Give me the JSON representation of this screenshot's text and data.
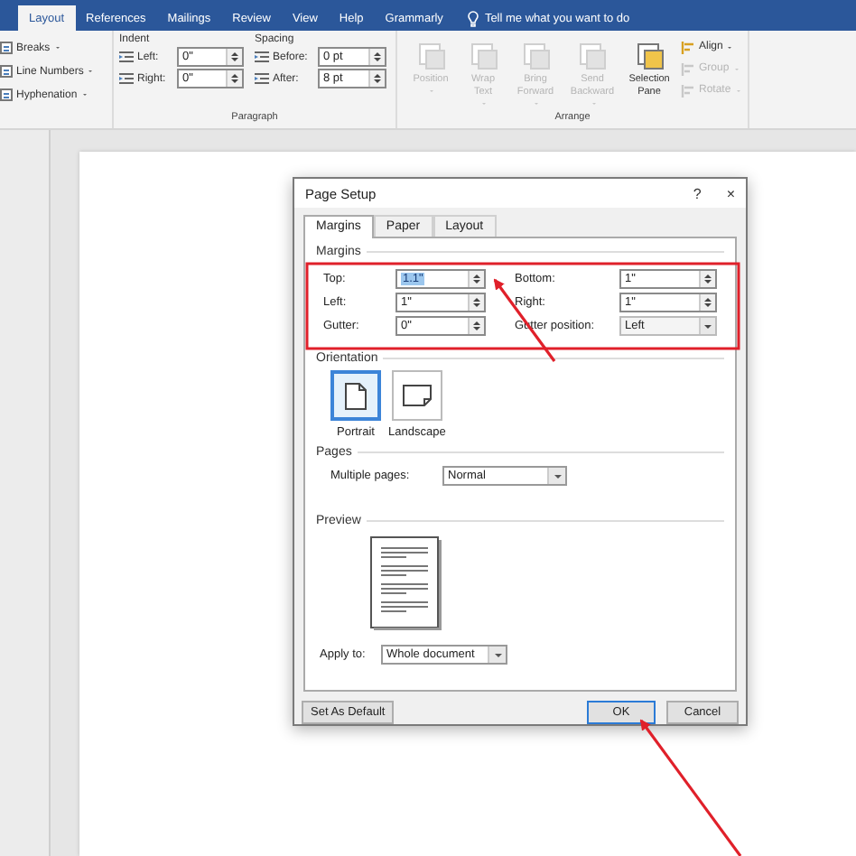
{
  "ribbon": {
    "tabs": [
      {
        "label": "Layout",
        "selected": true
      },
      {
        "label": "References",
        "selected": false
      },
      {
        "label": "Mailings",
        "selected": false
      },
      {
        "label": "Review",
        "selected": false
      },
      {
        "label": "View",
        "selected": false
      },
      {
        "label": "Help",
        "selected": false
      },
      {
        "label": "Grammarly",
        "selected": false
      }
    ],
    "tell_me": "Tell me what you want to do",
    "setup_items": [
      "Breaks",
      "Line Numbers",
      "Hyphenation"
    ],
    "paragraph": {
      "title": "Paragraph",
      "indent_label": "Indent",
      "spacing_label": "Spacing",
      "indent": [
        {
          "label": "Left:",
          "value": "0\""
        },
        {
          "label": "Right:",
          "value": "0\""
        }
      ],
      "spacing": [
        {
          "label": "Before:",
          "value": "0 pt"
        },
        {
          "label": "After:",
          "value": "8 pt"
        }
      ]
    },
    "arrange": {
      "title": "Arrange",
      "large": [
        {
          "label": "Position",
          "disabled": true,
          "dropdown": true
        },
        {
          "label": "Wrap Text",
          "disabled": true,
          "dropdown": true
        },
        {
          "label": "Bring Forward",
          "disabled": true,
          "dropdown": true
        },
        {
          "label": "Send Backward",
          "disabled": true,
          "dropdown": true
        },
        {
          "label": "Selection Pane",
          "disabled": false,
          "dropdown": false
        }
      ],
      "small": [
        {
          "label": "Align",
          "disabled": false
        },
        {
          "label": "Group",
          "disabled": true
        },
        {
          "label": "Rotate",
          "disabled": true
        }
      ]
    }
  },
  "dialog": {
    "title": "Page Setup",
    "help": "?",
    "close": "×",
    "tabs": [
      {
        "label": "Margins",
        "selected": true
      },
      {
        "label": "Paper",
        "selected": false
      },
      {
        "label": "Layout",
        "selected": false
      }
    ],
    "margins": {
      "title": "Margins",
      "fields": [
        {
          "label": "Top:",
          "value": "1.1\"",
          "kind": "spin",
          "highlighted": true
        },
        {
          "label": "Bottom:",
          "value": "1\"",
          "kind": "spin",
          "highlighted": false
        },
        {
          "label": "Left:",
          "value": "1\"",
          "kind": "spin",
          "highlighted": false
        },
        {
          "label": "Right:",
          "value": "1\"",
          "kind": "spin",
          "highlighted": false
        },
        {
          "label": "Gutter:",
          "value": "0\"",
          "kind": "spin",
          "highlighted": false
        },
        {
          "label": "Gutter position:",
          "value": "Left",
          "kind": "dropdown",
          "highlighted": false
        }
      ]
    },
    "orientation": {
      "title": "Orientation",
      "options": [
        {
          "label": "Portrait",
          "kind": "portrait",
          "selected": true
        },
        {
          "label": "Landscape",
          "kind": "landscape",
          "selected": false
        }
      ]
    },
    "pages": {
      "title": "Pages",
      "label": "Multiple pages:",
      "value": "Normal"
    },
    "preview": {
      "title": "Preview"
    },
    "apply_to": {
      "label": "Apply to:",
      "value": "Whole document"
    },
    "buttons": [
      {
        "label": "Set As Default",
        "default": false
      },
      {
        "label": "OK",
        "default": true
      },
      {
        "label": "Cancel",
        "default": false
      }
    ]
  }
}
